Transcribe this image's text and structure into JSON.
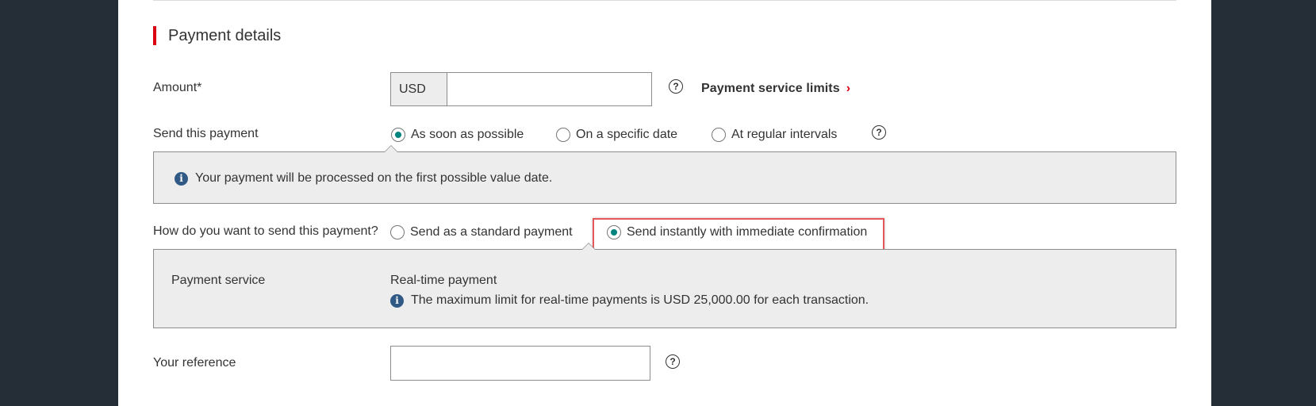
{
  "section": {
    "title": "Payment details"
  },
  "amount": {
    "label": "Amount*",
    "currency": "USD",
    "value": "",
    "limits_link": "Payment service limits"
  },
  "send_timing": {
    "label": "Send this payment",
    "options": [
      {
        "label": "As soon as possible",
        "checked": true
      },
      {
        "label": "On a specific date",
        "checked": false
      },
      {
        "label": "At regular intervals",
        "checked": false
      }
    ],
    "info": "Your payment will be processed on the first possible value date."
  },
  "send_method": {
    "label": "How do you want to send this payment?",
    "options": [
      {
        "label": "Send as a standard payment",
        "checked": false
      },
      {
        "label": "Send instantly with immediate confirmation",
        "checked": true
      }
    ],
    "service_label": "Payment service",
    "service_value": "Real-time payment",
    "limit_info": "The maximum limit for real-time payments is USD 25,000.00 for each transaction."
  },
  "reference": {
    "label": "Your reference",
    "value": ""
  },
  "icons": {
    "help": "?",
    "info": "i",
    "chevron": "›"
  },
  "colors": {
    "accent_red": "#db0011",
    "radio_teal": "#00847f",
    "info_blue": "#305a85",
    "highlight": "#e4575a"
  }
}
